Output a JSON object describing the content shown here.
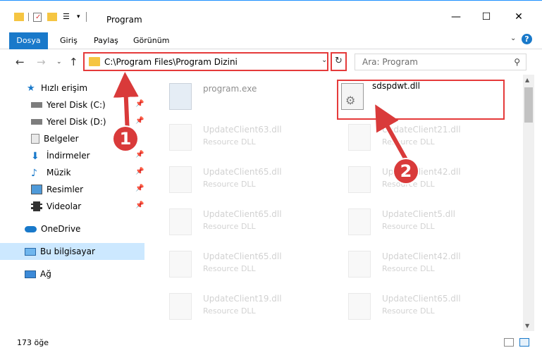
{
  "window": {
    "title": "Program",
    "minimize": "—",
    "maximize": "☐",
    "close": "✕"
  },
  "ribbon": {
    "tabs": [
      "Dosya",
      "Giriş",
      "Paylaş",
      "Görünüm"
    ],
    "help": "?"
  },
  "address": {
    "path": "C:\\Program Files\\Program Dizini",
    "search_placeholder": "Ara: Program"
  },
  "sidebar": {
    "items": [
      {
        "label": "Hızlı erişim",
        "icon": "star-icon"
      },
      {
        "label": "Yerel Disk (C:)",
        "icon": "drive-icon"
      },
      {
        "label": "Yerel Disk (D:)",
        "icon": "drive-icon"
      },
      {
        "label": "Belgeler",
        "icon": "documents-icon"
      },
      {
        "label": "İndirmeler",
        "icon": "download-icon"
      },
      {
        "label": "Müzik",
        "icon": "music-icon"
      },
      {
        "label": "Resimler",
        "icon": "pictures-icon"
      },
      {
        "label": "Videolar",
        "icon": "videos-icon"
      },
      {
        "label": "OneDrive",
        "icon": "cloud-icon"
      },
      {
        "label": "Bu bilgisayar",
        "icon": "computer-icon"
      },
      {
        "label": "Ağ",
        "icon": "network-icon"
      }
    ]
  },
  "files": [
    {
      "name": "program.exe",
      "type": ""
    },
    {
      "name": "sdspdwt.dll",
      "type": ""
    },
    {
      "name": "UpdateClient63.dll",
      "type": "Resource DLL"
    },
    {
      "name": "UpdateClient21.dll",
      "type": "Resource DLL"
    },
    {
      "name": "UpdateClient65.dll",
      "type": "Resource DLL"
    },
    {
      "name": "UpdateClient42.dll",
      "type": "Resource DLL"
    },
    {
      "name": "UpdateClient65.dll",
      "type": "Resource DLL"
    },
    {
      "name": "UpdateClient5.dll",
      "type": "Resource DLL"
    },
    {
      "name": "UpdateClient65.dll",
      "type": "Resource DLL"
    },
    {
      "name": "UpdateClient42.dll",
      "type": "Resource DLL"
    },
    {
      "name": "UpdateClient19.dll",
      "type": "Resource DLL"
    },
    {
      "name": "UpdateClient65.dll",
      "type": "Resource DLL"
    }
  ],
  "status": {
    "count": "173 öğe"
  },
  "annotations": {
    "step1": "1",
    "step2": "2"
  },
  "colors": {
    "accent": "#1979ca",
    "highlight": "#e53a3a",
    "selection": "#cce8ff"
  }
}
